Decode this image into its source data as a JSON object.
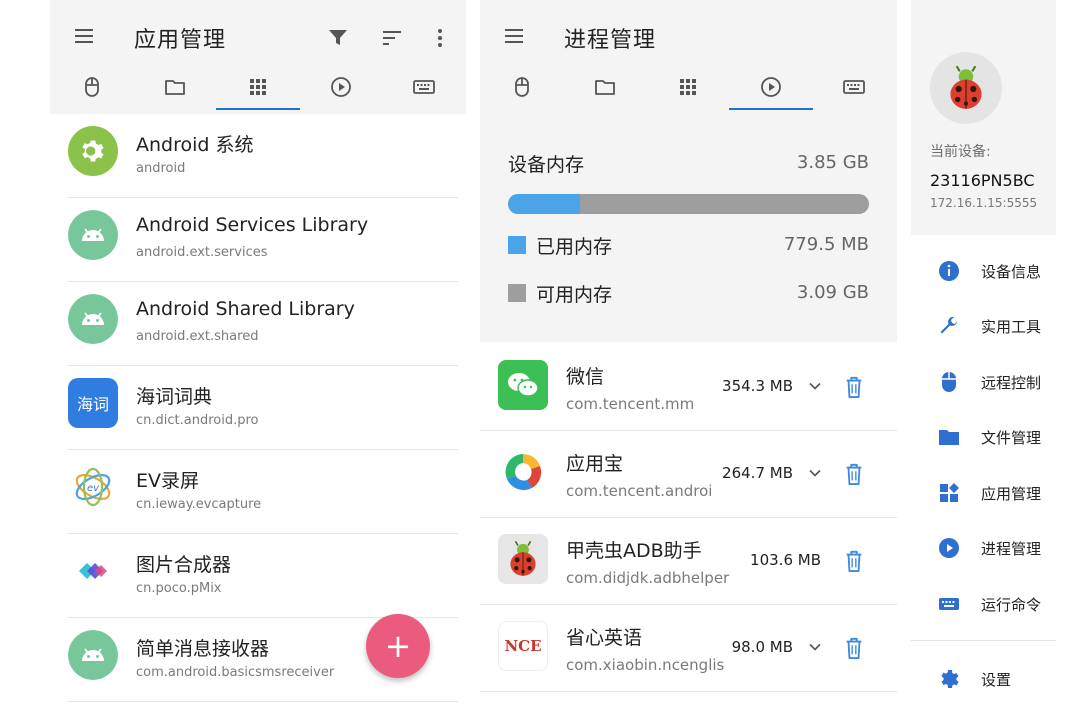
{
  "colors": {
    "accent": "#1e73c8",
    "fab": "#ea5b7e",
    "used_memory": "#4ba3e8",
    "free_memory": "#9e9e9e"
  },
  "app_manager": {
    "title": "应用管理",
    "tabs": [
      "mouse-icon",
      "folder-icon",
      "grid-icon",
      "play-circle-icon",
      "keyboard-icon"
    ],
    "active_tab": 2,
    "apps": [
      {
        "name": "Android 系统",
        "package": "android",
        "icon": "android-settings-icon"
      },
      {
        "name": "Android Services Library",
        "package": "android.ext.services",
        "icon": "android-icon"
      },
      {
        "name": "Android Shared Library",
        "package": "android.ext.shared",
        "icon": "android-icon"
      },
      {
        "name": "海词词典",
        "package": "cn.dict.android.pro",
        "icon": "haici-icon",
        "icon_text": "海词"
      },
      {
        "name": "EV录屏",
        "package": "cn.ieway.evcapture",
        "icon": "ev-icon"
      },
      {
        "name": "图片合成器",
        "package": "cn.poco.pMix",
        "icon": "pmix-icon"
      },
      {
        "name": "简单消息接收器",
        "package": "com.android.basicsmsreceiver",
        "icon": "android-icon"
      }
    ],
    "fab_label": "+"
  },
  "process_manager": {
    "title": "进程管理",
    "tabs": [
      "mouse-icon",
      "folder-icon",
      "grid-icon",
      "play-circle-icon",
      "keyboard-icon"
    ],
    "active_tab": 3,
    "memory": {
      "title": "设备内存",
      "total": "3.85 GB",
      "used_label": "已用内存",
      "used": "779.5 MB",
      "free_label": "可用内存",
      "free": "3.09 GB",
      "used_fraction": 0.2
    },
    "processes": [
      {
        "name": "微信",
        "package": "com.tencent.mm",
        "size": "354.3 MB",
        "icon": "wechat-icon",
        "expandable": true
      },
      {
        "name": "应用宝",
        "package": "com.tencent.androi",
        "size": "264.7 MB",
        "icon": "yingyongbao-icon",
        "expandable": true
      },
      {
        "name": "甲壳虫ADB助手",
        "package": "com.didjdk.adbhelper",
        "size": "103.6 MB",
        "icon": "ladybug-icon",
        "expandable": false
      },
      {
        "name": "省心英语",
        "package": "com.xiaobin.ncenglis",
        "size": "98.0 MB",
        "icon": "nce-icon",
        "icon_text": "NCE",
        "expandable": true
      }
    ]
  },
  "device_drawer": {
    "current_device_label": "当前设备:",
    "device_name": "23116PN5BC",
    "device_ip": "172.16.1.15:5555",
    "nav": [
      {
        "label": "设备信息",
        "icon": "info-icon"
      },
      {
        "label": "实用工具",
        "icon": "wrench-icon"
      },
      {
        "label": "远程控制",
        "icon": "mouse-icon"
      },
      {
        "label": "文件管理",
        "icon": "folder-icon"
      },
      {
        "label": "应用管理",
        "icon": "apps-icon"
      },
      {
        "label": "进程管理",
        "icon": "play-circle-icon"
      },
      {
        "label": "运行命令",
        "icon": "keyboard-icon"
      }
    ],
    "settings_label": "设置"
  }
}
